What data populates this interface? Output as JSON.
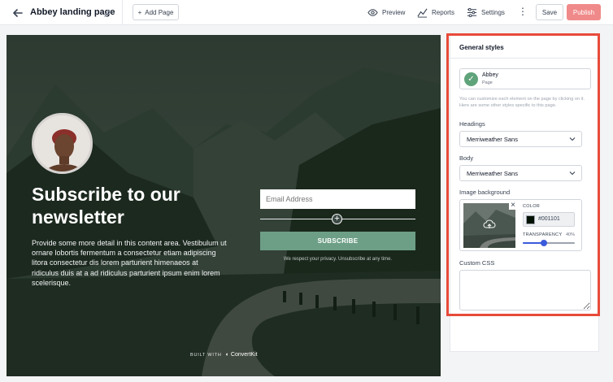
{
  "topbar": {
    "page_title": "Abbey landing page",
    "add_page_label": "Add Page",
    "preview_label": "Preview",
    "reports_label": "Reports",
    "settings_label": "Settings",
    "save_label": "Save",
    "publish_label": "Publish"
  },
  "canvas": {
    "headline": "Subscribe to our newsletter",
    "description": "Provide some more detail in this content area. Vestibulum ut ornare lobortis fermentum a consectetur etiam adipiscing litora consectetur dis lorem parturient himenaeos at ridiculus duis at a ad ridiculus parturient ipsum enim lorem scelerisque.",
    "email_placeholder": "Email Address",
    "subscribe_label": "SUBSCRIBE",
    "privacy_text": "We respect your privacy. Unsubscribe at any time.",
    "built_with": "BUILT WITH",
    "brand": "ConvertKit"
  },
  "panel": {
    "title": "General styles",
    "theme_name": "Abbey",
    "theme_type": "Page",
    "help_text": "You can customize each element on the page by clicking on it. Here are some other styles specific to this page.",
    "headings_label": "Headings",
    "headings_font": "Merriweather Sans",
    "body_label": "Body",
    "body_font": "Merriweather Sans",
    "image_bg_label": "Image background",
    "color_label": "COLOR",
    "color_value": "#001101",
    "transparency_label": "TRANSPARENCY",
    "transparency_value": "40%",
    "transparency_fraction": 0.4,
    "custom_css_label": "Custom CSS"
  },
  "colors": {
    "publish": "#f08a8a",
    "subscribe": "#6d9f86",
    "highlight": "#e84a3a",
    "slider": "#3b5bdb",
    "overlay": "#001101"
  }
}
